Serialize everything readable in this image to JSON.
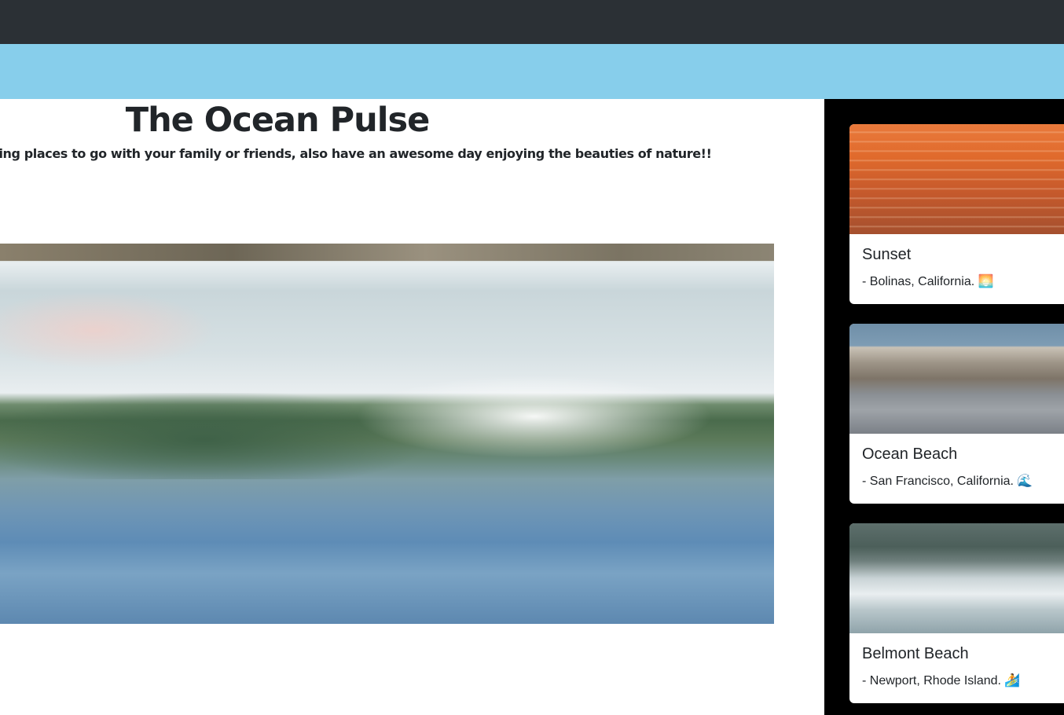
{
  "header": {
    "title": "The Ocean Pulse",
    "subtitle": "Get the ocean and surfing places to go with your family or friends, also have an awesome day enjoying the beauties of nature!!"
  },
  "hero": {
    "image": "wave-photo"
  },
  "cards": [
    {
      "title": "Sunset",
      "text": "- Bolinas, California. 🌅",
      "image": "sunset-photo"
    },
    {
      "title": "Ocean Beach",
      "text": "- San Francisco, California. 🌊",
      "image": "ocean-beach-photo"
    },
    {
      "title": "Belmont Beach",
      "text": "- Newport, Rhode Island. 🏄",
      "image": "belmont-beach-photo"
    }
  ],
  "colors": {
    "navbar": "#2b3035",
    "banner": "#87ceeb",
    "sidebar": "#000000",
    "text": "#212529"
  }
}
